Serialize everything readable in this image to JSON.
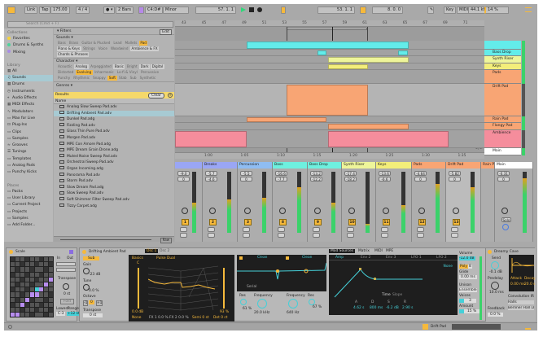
{
  "toolbar": {
    "link": "Link",
    "tap": "Tap",
    "tempo": "175.00",
    "sig": "4 / 4",
    "quant": "2 Bars",
    "key": "C4:D#",
    "scale": "Minor",
    "position": "57. 1. 1",
    "loop_start": "53. 1. 1",
    "loop_len": "8. 0. 0",
    "key_btn": "Key",
    "midi": "MIDI",
    "rate": "44.1 kHz",
    "cpu": "14 %"
  },
  "browser": {
    "search_placeholder": "Search (Cmd + F)",
    "collections_title": "Collections",
    "collections": [
      {
        "label": "Favorites",
        "color": "#f5d23b"
      },
      {
        "label": "Drums & Synths",
        "color": "#4fd39b"
      },
      {
        "label": "Mixing",
        "color": "#a98de6"
      }
    ],
    "library_title": "Library",
    "library": [
      {
        "label": "All",
        "icon": "grid"
      },
      {
        "label": "Sounds",
        "icon": "note"
      },
      {
        "label": "Drums",
        "icon": "grid"
      },
      {
        "label": "Instruments",
        "icon": "clock"
      },
      {
        "label": "Audio Effects",
        "icon": "fx"
      },
      {
        "label": "MIDI Effects",
        "icon": "grid"
      },
      {
        "label": "Modulators",
        "icon": "mod"
      },
      {
        "label": "Max for Live",
        "icon": "box"
      },
      {
        "label": "Plug-Ins",
        "icon": "plug"
      },
      {
        "label": "Clips",
        "icon": "box"
      },
      {
        "label": "Samples",
        "icon": "box"
      },
      {
        "label": "Grooves",
        "icon": "wave"
      },
      {
        "label": "Tunings",
        "icon": "tune"
      },
      {
        "label": "Templates",
        "icon": "box"
      },
      {
        "label": "Analog Pads",
        "icon": "box"
      },
      {
        "label": "Punchy Kicks",
        "icon": "box"
      }
    ],
    "places_title": "Places",
    "places": [
      {
        "label": "Packs"
      },
      {
        "label": "User Library"
      },
      {
        "label": "Current Project"
      },
      {
        "label": "Projects"
      },
      {
        "label": "Samples"
      },
      {
        "label": "Add Folder..."
      }
    ],
    "filters_label": "Filters",
    "edit_label": "Edit",
    "sounds_label": "Sounds ▾",
    "sounds_tags": [
      {
        "t": "Bass",
        "s": 0
      },
      {
        "t": "Brass",
        "s": 0
      },
      {
        "t": "Guitar & Plucked",
        "s": 0
      },
      {
        "t": "Lead",
        "s": 0
      },
      {
        "t": "Mallets",
        "s": 0
      },
      {
        "t": "Pad",
        "s": 2
      },
      {
        "t": "Piano & Keys",
        "s": 1
      },
      {
        "t": "Strings",
        "s": 0
      },
      {
        "t": "Voice",
        "s": 0
      },
      {
        "t": "Woodwind",
        "s": 0
      },
      {
        "t": "Ambience & FX",
        "s": 1
      },
      {
        "t": "Chords & Phrases",
        "s": 1
      }
    ],
    "character_label": "Character ▾",
    "character_tags": [
      {
        "t": "Acoustic",
        "s": 0
      },
      {
        "t": "Analog",
        "s": 1
      },
      {
        "t": "Arpeggiated",
        "s": 0
      },
      {
        "t": "Basic",
        "s": 1
      },
      {
        "t": "Bright",
        "s": 0
      },
      {
        "t": "Dark",
        "s": 1
      },
      {
        "t": "Digital",
        "s": 1
      },
      {
        "t": "Distorted",
        "s": 0
      },
      {
        "t": "Evolving",
        "s": 2
      },
      {
        "t": "Inharmonic",
        "s": 0
      },
      {
        "t": "Lo-fi & Vinyl",
        "s": 0
      },
      {
        "t": "Percussive",
        "s": 0
      },
      {
        "t": "Punchy",
        "s": 0
      },
      {
        "t": "Rhythmic",
        "s": 0
      },
      {
        "t": "Snappy",
        "s": 0
      },
      {
        "t": "Soft",
        "s": 2
      },
      {
        "t": "Stab",
        "s": 0
      },
      {
        "t": "Sub",
        "s": 0
      },
      {
        "t": "Synthetic",
        "s": 0
      }
    ],
    "genres_label": "Genres ▾",
    "results_label": "Results",
    "clear_label": "Clear",
    "name_col": "Name",
    "files": [
      "Analog Slow Sweep Pad.adv",
      "Drifting Ambient Pad.adv",
      "Dunkel Pad.adg",
      "Fizzling Pad.adv",
      "Glass Thin Pure Pad.adv",
      "Morgen Pad.adv",
      "MPE Con Amore Pad.adg",
      "MPE Dream Grain Drone.adg",
      "Muted Noise Sweep Pad.adv",
      "Orchestral Sweep Pad.adv",
      "Organ Incoming.adg",
      "Panorama Pad.adv",
      "Storm Pad.adv",
      "Slow Dream Pad.adg",
      "Slow Sweep Pad.adv",
      "Soft Shimmer Filter Sweep Pad.adv",
      "Tizzy Carpet.adg"
    ],
    "selected_file": 1,
    "preview_label": "Raw"
  },
  "arrangement": {
    "ruler": [
      "43",
      "45",
      "47",
      "49",
      "51",
      "53",
      "55",
      "57",
      "59",
      "61",
      "63",
      "65",
      "67",
      "69",
      "71"
    ],
    "time_ruler": [
      "1:00",
      "1:05",
      "1:10",
      "1:15",
      "1:20",
      "1:25",
      "1:30",
      "1:35"
    ],
    "zoom_label": "1/2",
    "tracks": [
      {
        "name": "",
        "color": "#63ecea"
      },
      {
        "name": "Bass Drop",
        "color": "#63ecea"
      },
      {
        "name": "Synth Riser",
        "color": "#eef59a"
      },
      {
        "name": "Keys",
        "color": "#f3ee7a"
      },
      {
        "name": "Pads",
        "color": "#f8a574"
      },
      {
        "name": "Drift Pad",
        "color": "#f8a574"
      },
      {
        "name": "Rain Pad",
        "color": "#f8a574"
      },
      {
        "name": "Flangy Pad",
        "color": "#f8a574"
      },
      {
        "name": "Ambience",
        "color": "#f58d9c"
      },
      {
        "name": "Main",
        "color": "#ffffff"
      }
    ]
  },
  "mixer": [
    {
      "name": "",
      "color": "#9aa6f5",
      "vol": "-9.0",
      "pan": "0",
      "num": "1",
      "level": 0.5
    },
    {
      "name": "Breaks",
      "color": "#9aa6f5",
      "vol": "-5.7",
      "pan": "-4.6",
      "num": "2",
      "level": 0.55
    },
    {
      "name": "Percussion",
      "color": "#8fbdf2",
      "vol": "-5.5",
      "pan": "0",
      "num": "3",
      "level": 0.58
    },
    {
      "name": "Bass",
      "color": "#6ef0df",
      "vol": "-16.6",
      "pan": "-7.7",
      "num": "8",
      "level": 0.75
    },
    {
      "name": "Bass Drop",
      "color": "#6ef0df",
      "vol": "-13.2",
      "pan": "-12.2",
      "num": "9",
      "level": 0.5
    },
    {
      "name": "Synth Riser",
      "color": "#eef59a",
      "vol": "-17.4",
      "pan": "-18.2",
      "num": "10",
      "level": 0.15
    },
    {
      "name": "Keys",
      "color": "#f3ee7a",
      "vol": "-13.6",
      "pan": "-6.6",
      "num": "11",
      "level": 0.45
    },
    {
      "name": "Pads",
      "color": "#f8a574",
      "vol": "-4.64",
      "pan": "0",
      "num": "12",
      "level": 0.8
    },
    {
      "name": "Drift Pad",
      "color": "#f8a574",
      "vol": "-5.82",
      "pan": "0",
      "num": "13",
      "level": 0.75
    },
    {
      "name": "Rain P",
      "color": "#f8a574",
      "vol": "-13",
      "pan": "0",
      "num": "14",
      "level": 0.4
    },
    {
      "name": "Main",
      "color": "#ffffff",
      "vol": "-0.31",
      "pan": "0",
      "num": "Solo",
      "level": 0.9
    }
  ],
  "devices": {
    "scale": {
      "title": "Scale",
      "in": "In",
      "out": "Out",
      "transpose": "Transpose",
      "transpose_val": "0 st",
      "fold": "Fold",
      "lowest": "Lowest",
      "range": "Range",
      "lowest_val": "C-3",
      "range_val": "+12 st"
    },
    "drift": {
      "title": "Drifting Ambient Pad",
      "osc1": "Osc 1",
      "osc2": "Osc 2",
      "sub": "Sub",
      "gain": "Gain",
      "gain_val": "-23 dB",
      "tune": "Tune",
      "tune_val": "0.0 %",
      "octave": "Octave",
      "oct_vals": [
        "-1",
        "0",
        "+1"
      ],
      "transpose": "Transpose",
      "transpose_val": "0 st",
      "basics": "Basics",
      "wave": "Pulse Dual",
      "db": "0.0 dB",
      "pct": "93 %",
      "none": "None",
      "fx1": "FX 1  0.0 %",
      "fx2": "FX 2  0.0 %",
      "semi": "Semi  0 st",
      "det": "Det  0 ct",
      "note": "C"
    },
    "filter": {
      "f1": "Clean",
      "f2": "Clean",
      "mode": "Serial",
      "res1": "Res",
      "res1_val": "61 %",
      "freq1": "Frequency",
      "freq1_val": "20.0 kHz",
      "freq2": "Frequency",
      "freq2_val": "640 Hz",
      "res2": "Res",
      "res2_val": "67 %"
    },
    "mod": {
      "tabs": [
        "Mod Sources",
        "Matrix",
        "MIDI",
        "MPE"
      ],
      "subtabs": [
        "Amp",
        "Env 2",
        "Env 3",
        "LFO 1",
        "LFO 2"
      ],
      "time": "Time",
      "slope": "Slope",
      "adsr": [
        "A",
        "D",
        "S",
        "R"
      ],
      "adsr_vals": [
        "4.62 s",
        "800 ms",
        "-6.2 dB",
        "2.90 s"
      ],
      "none": "None",
      "volume": "Volume",
      "volume_val": "-12.0 dB",
      "poly": "Poly",
      "poly_val": "8",
      "glide": "Glide",
      "glide_val": "0.00 ms",
      "unison": "Unison",
      "unison_val": "Ensemble",
      "voices": "Voices",
      "voices_val": "3",
      "amount": "Amount",
      "amount_val": "15 %"
    },
    "reverb": {
      "title": "Dreamy Cave",
      "send": "Send",
      "send_val": "-0.1 dB",
      "predelay": "Predelay",
      "predelay_val": "10.0 ms",
      "attack": "Attack",
      "attack_val": "0.00 ms",
      "decay": "Decay",
      "decay_val": "20.0 s",
      "ir": "Convolution IR",
      "ir_cat": "Halls",
      "ir_name": "Berliner Hall LR",
      "feedback": "Feedback",
      "feedback_val": "0.0 %"
    }
  },
  "status": {
    "track": "Drift Pad"
  },
  "colors": {
    "accent": "#f6b93b",
    "cyan": "#45d0d8",
    "selection": "#a7cad3"
  }
}
